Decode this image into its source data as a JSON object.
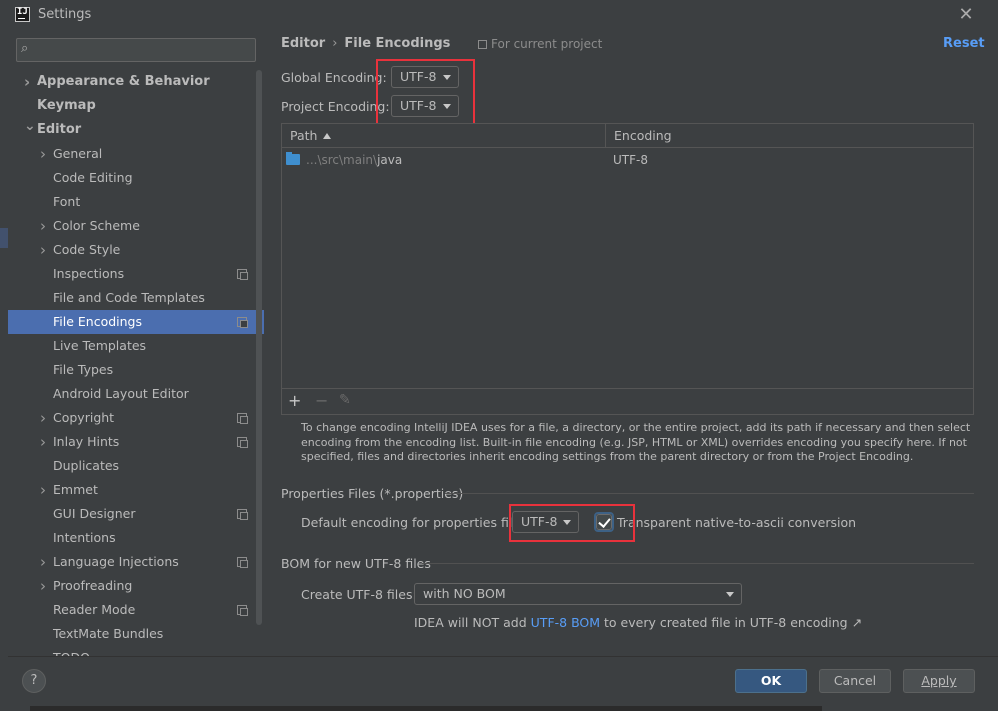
{
  "window": {
    "title": "Settings",
    "app_icon_text": "IJ"
  },
  "search": {
    "placeholder": ""
  },
  "sidebar": {
    "items": [
      {
        "label": "Appearance & Behavior",
        "level": 0,
        "chevron": ">",
        "bold": true
      },
      {
        "label": "Keymap",
        "level": 0,
        "chevron": "",
        "bold": true
      },
      {
        "label": "Editor",
        "level": 0,
        "chevron": "v",
        "bold": true
      },
      {
        "label": "General",
        "level": 1,
        "chevron": ">"
      },
      {
        "label": "Code Editing",
        "level": 1,
        "chevron": ""
      },
      {
        "label": "Font",
        "level": 1,
        "chevron": ""
      },
      {
        "label": "Color Scheme",
        "level": 1,
        "chevron": ">"
      },
      {
        "label": "Code Style",
        "level": 1,
        "chevron": ">"
      },
      {
        "label": "Inspections",
        "level": 1,
        "chevron": "",
        "project_icon": true
      },
      {
        "label": "File and Code Templates",
        "level": 1,
        "chevron": ""
      },
      {
        "label": "File Encodings",
        "level": 1,
        "chevron": "",
        "project_icon": true,
        "selected": true
      },
      {
        "label": "Live Templates",
        "level": 1,
        "chevron": ""
      },
      {
        "label": "File Types",
        "level": 1,
        "chevron": ""
      },
      {
        "label": "Android Layout Editor",
        "level": 1,
        "chevron": ""
      },
      {
        "label": "Copyright",
        "level": 1,
        "chevron": ">",
        "project_icon": true
      },
      {
        "label": "Inlay Hints",
        "level": 1,
        "chevron": ">",
        "project_icon": true
      },
      {
        "label": "Duplicates",
        "level": 1,
        "chevron": ""
      },
      {
        "label": "Emmet",
        "level": 1,
        "chevron": ">"
      },
      {
        "label": "GUI Designer",
        "level": 1,
        "chevron": "",
        "project_icon": true
      },
      {
        "label": "Intentions",
        "level": 1,
        "chevron": ""
      },
      {
        "label": "Language Injections",
        "level": 1,
        "chevron": ">",
        "project_icon": true
      },
      {
        "label": "Proofreading",
        "level": 1,
        "chevron": ">"
      },
      {
        "label": "Reader Mode",
        "level": 1,
        "chevron": "",
        "project_icon": true
      },
      {
        "label": "TextMate Bundles",
        "level": 1,
        "chevron": ""
      },
      {
        "label": "TODO",
        "level": 1,
        "chevron": ""
      }
    ]
  },
  "header": {
    "breadcrumb_parent": "Editor",
    "breadcrumb_sep": "›",
    "breadcrumb_current": "File Encodings",
    "scope": "For current project",
    "reset": "Reset"
  },
  "encodings": {
    "global_label": "Global Encoding:",
    "global_value": "UTF-8",
    "project_label": "Project Encoding:",
    "project_value": "UTF-8"
  },
  "table": {
    "columns": [
      "Path",
      "Encoding"
    ],
    "rows": [
      {
        "path_prefix": "...\\src\\main\\",
        "path_name": "java",
        "encoding": "UTF-8"
      }
    ],
    "toolbar": {
      "add": "+",
      "remove": "−",
      "edit": "✎"
    }
  },
  "description": "To change encoding IntelliJ IDEA uses for a file, a directory, or the entire project, add its path if necessary and then select encoding from the encoding list. Built-in file encoding (e.g. JSP, HTML or XML) overrides encoding you specify here. If not specified, files and directories inherit encoding settings from the parent directory or from the Project Encoding.",
  "properties": {
    "section_title": "Properties Files (*.properties)",
    "default_label": "Default encoding for properties files:",
    "default_value": "UTF-8",
    "native_to_ascii_label": "Transparent native-to-ascii conversion",
    "native_to_ascii_checked": true
  },
  "bom": {
    "section_title": "BOM for new UTF-8 files",
    "create_label": "Create UTF-8 files:",
    "create_value": "with NO BOM",
    "note_prefix": "IDEA will NOT add ",
    "note_link": "UTF-8 BOM",
    "note_suffix": " to every created file in UTF-8 encoding ↗"
  },
  "footer": {
    "help": "?",
    "ok": "OK",
    "cancel": "Cancel",
    "apply": "Apply"
  },
  "colors": {
    "background": "#3c3f41",
    "selection": "#4b6eaf",
    "link": "#589df6",
    "highlight_box": "#e8323c",
    "primary_button": "#365880"
  }
}
